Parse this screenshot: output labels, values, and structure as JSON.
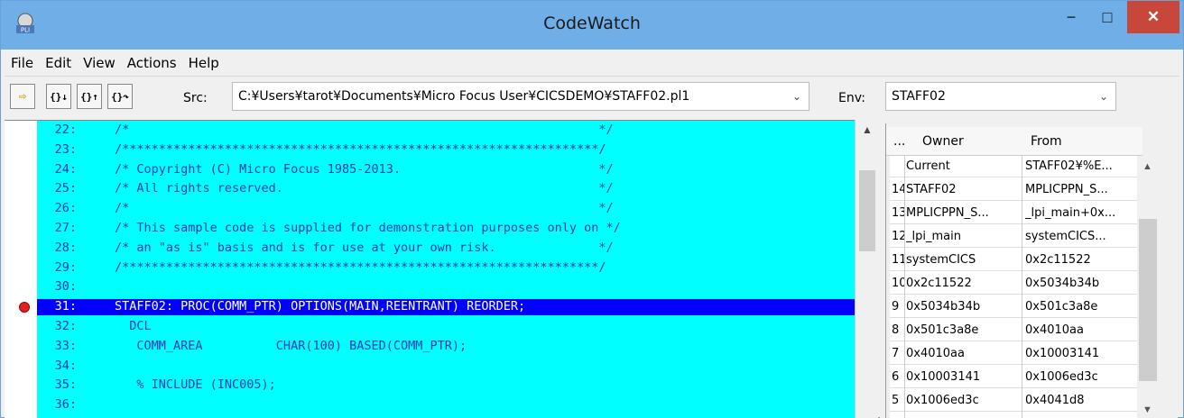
{
  "window": {
    "title": "CodeWatch",
    "minimize": "−",
    "maximize": "□",
    "close": "✕"
  },
  "menu": [
    "File",
    "Edit",
    "View",
    "Actions",
    "Help"
  ],
  "toolbar": {
    "buttons": [
      "⇨",
      "{}↓",
      "{}↑",
      "{}↷"
    ],
    "src_label": "Src:",
    "src_value": "C:¥Users¥tarot¥Documents¥Micro Focus User¥CICSDEMO¥STAFF02.pl1",
    "env_label": "Env:",
    "env_value": "STAFF02"
  },
  "code": {
    "lines": [
      {
        "num": "22:",
        "text": "/*                                                                */"
      },
      {
        "num": "23:",
        "text": "/*****************************************************************/"
      },
      {
        "num": "24:",
        "text": "/* Copyright (C) Micro Focus 1985-2013.                           */"
      },
      {
        "num": "25:",
        "text": "/* All rights reserved.                                           */"
      },
      {
        "num": "26:",
        "text": "/*                                                                */"
      },
      {
        "num": "27:",
        "text": "/* This sample code is supplied for demonstration purposes only on */"
      },
      {
        "num": "28:",
        "text": "/* an \"as is\" basis and is for use at your own risk.              */"
      },
      {
        "num": "29:",
        "text": "/*****************************************************************/"
      },
      {
        "num": "30:",
        "text": ""
      },
      {
        "num": "31:",
        "text": "STAFF02: PROC(COMM_PTR) OPTIONS(MAIN,REENTRANT) REORDER;"
      },
      {
        "num": "32:",
        "text": "  DCL"
      },
      {
        "num": "33:",
        "text": "   COMM_AREA          CHAR(100) BASED(COMM_PTR);"
      },
      {
        "num": "34:",
        "text": ""
      },
      {
        "num": "35:",
        "text": "   % INCLUDE (INC005);"
      },
      {
        "num": "36:",
        "text": ""
      }
    ],
    "highlighted_line": 9,
    "breakpoint_line": 9
  },
  "stack": {
    "headers": [
      "...",
      "Owner",
      "From"
    ],
    "rows": [
      {
        "n": "",
        "owner": "Current",
        "from": "STAFF02¥%E..."
      },
      {
        "n": "14",
        "owner": "STAFF02",
        "from": "MPLICPPN_S..."
      },
      {
        "n": "13",
        "owner": "MPLICPPN_S...",
        "from": "_lpi_main+0x..."
      },
      {
        "n": "12",
        "owner": "_lpi_main",
        "from": "systemCICS..."
      },
      {
        "n": "11",
        "owner": "systemCICS",
        "from": "0x2c11522"
      },
      {
        "n": "10",
        "owner": "0x2c11522",
        "from": "0x5034b34b"
      },
      {
        "n": "9",
        "owner": "0x5034b34b",
        "from": "0x501c3a8e"
      },
      {
        "n": "8",
        "owner": "0x501c3a8e",
        "from": "0x4010aa"
      },
      {
        "n": "7",
        "owner": "0x4010aa",
        "from": "0x10003141"
      },
      {
        "n": "6",
        "owner": "0x10003141",
        "from": "0x1006ed3c"
      },
      {
        "n": "5",
        "owner": "0x1006ed3c",
        "from": "0x4041d8"
      }
    ]
  },
  "colors": {
    "titlebar": "#6faee6",
    "code_bg": "#00ffff",
    "highlight": "#0000ff",
    "close": "#c7483b"
  }
}
